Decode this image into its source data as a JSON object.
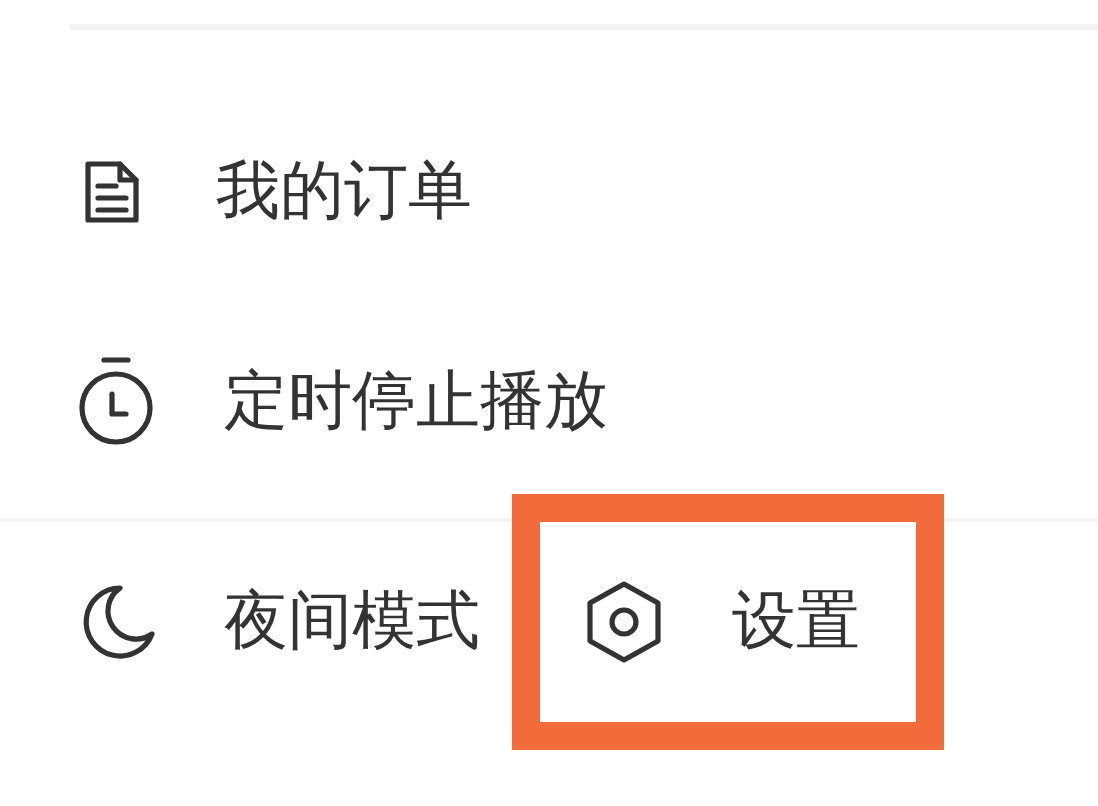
{
  "menu_items": [
    {
      "kind": "order",
      "label": "我的订单"
    },
    {
      "kind": "timer",
      "label": "定时停止播放"
    }
  ],
  "bottom_actions": [
    {
      "kind": "moon",
      "label": "夜间模式",
      "highlighted": false
    },
    {
      "kind": "settings",
      "label": "设置",
      "highlighted": true
    }
  ]
}
